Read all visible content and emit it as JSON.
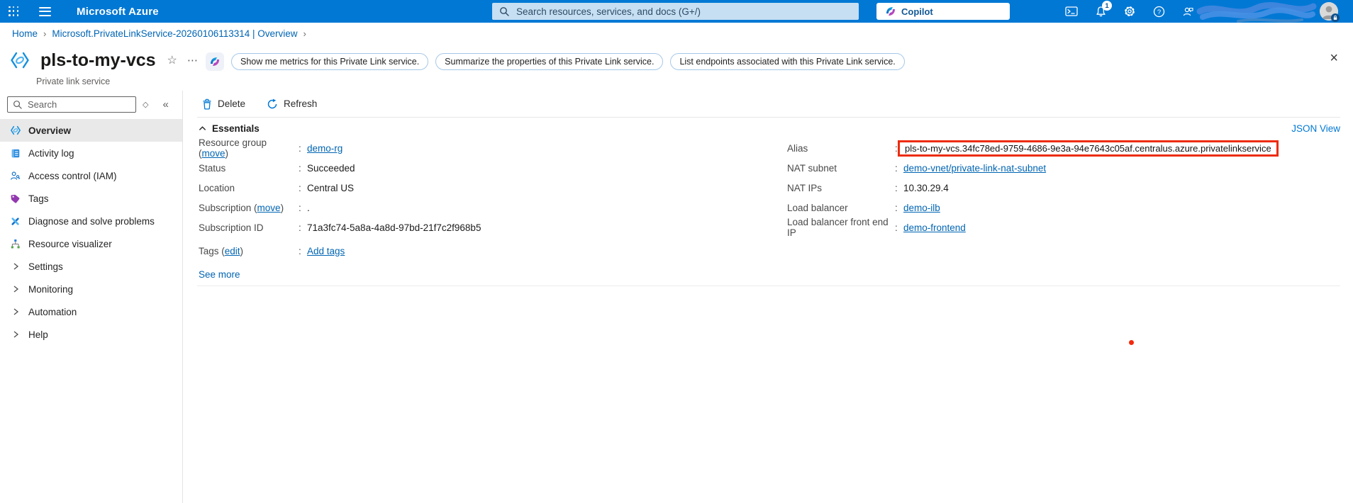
{
  "topbar": {
    "product": "Microsoft Azure",
    "search_placeholder": "Search resources, services, and docs (G+/)",
    "copilot": "Copilot",
    "notification_count": "1"
  },
  "breadcrumb": {
    "home": "Home",
    "resource": "Microsoft.PrivateLinkService-20260106113314 | Overview"
  },
  "header": {
    "title": "pls-to-my-vcs",
    "subtitle": "Private link service",
    "prompts": [
      "Show me metrics for this Private Link service.",
      "Summarize the properties of this Private Link service.",
      "List endpoints associated with this Private Link service."
    ]
  },
  "sidebar": {
    "search_placeholder": "Search",
    "items": [
      {
        "label": "Overview"
      },
      {
        "label": "Activity log"
      },
      {
        "label": "Access control (IAM)"
      },
      {
        "label": "Tags"
      },
      {
        "label": "Diagnose and solve problems"
      },
      {
        "label": "Resource visualizer"
      },
      {
        "label": "Settings"
      },
      {
        "label": "Monitoring"
      },
      {
        "label": "Automation"
      },
      {
        "label": "Help"
      }
    ]
  },
  "toolbar": {
    "delete": "Delete",
    "refresh": "Refresh"
  },
  "essentials": {
    "title": "Essentials",
    "json_view": "JSON View",
    "colon": ":",
    "see_more": "See more",
    "left": [
      {
        "label_pre": "Resource group (",
        "label_link": "move",
        "label_post": ")",
        "value": "demo-rg"
      },
      {
        "label_pre": "Status",
        "value": "Succeeded"
      },
      {
        "label_pre": "Location",
        "value": "Central US"
      },
      {
        "label_pre": "Subscription (",
        "label_link": "move",
        "label_post": ")",
        "value": "."
      },
      {
        "label_pre": "Subscription ID",
        "value": "71a3fc74-5a8a-4a8d-97bd-21f7c2f968b5"
      },
      {
        "label_pre": "Tags (",
        "label_link": "edit",
        "label_post": ")",
        "value": "Add tags"
      }
    ],
    "right": [
      {
        "label": "Alias",
        "value": "pls-to-my-vcs.34fc78ed-9759-4686-9e3a-94e7643c05af.centralus.azure.privatelinkservice"
      },
      {
        "label": "NAT subnet",
        "value": "demo-vnet/private-link-nat-subnet"
      },
      {
        "label": "NAT IPs",
        "value": "10.30.29.4"
      },
      {
        "label": "Load balancer",
        "value": "demo-ilb"
      },
      {
        "label": "Load balancer front end IP",
        "value": "demo-frontend"
      }
    ]
  },
  "annotations": {
    "alias_highlight_border": "#ed2c0e",
    "red_dot_color": "#f3290c",
    "account_redaction_color": "#3d85dd"
  },
  "colors": {
    "topbar": "#0078d4",
    "link": "#0065b3",
    "search_bg": "#c6dff2",
    "sidebar_selected_bg": "#e9e9e9"
  }
}
